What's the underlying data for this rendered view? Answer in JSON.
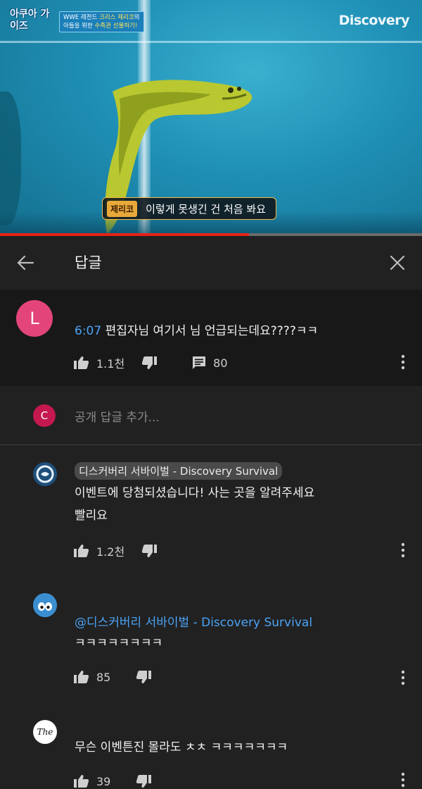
{
  "video": {
    "show_logo": "아쿠아 가이즈",
    "episode_banner_line1_a": "WWE 레전드 ",
    "episode_banner_line1_b": "크리스 제리코",
    "episode_banner_line1_c": "의",
    "episode_banner_line2_a": "아들을 위한 ",
    "episode_banner_line2_b": "수족관 선물하기!",
    "channel_watermark": "Discovery",
    "subtitle_speaker": "제리코",
    "subtitle_text": "이렇게 못생긴 건 처음 봐요",
    "progress_fraction": 0.59
  },
  "header": {
    "title": "답글",
    "back_icon": "arrow-left-icon",
    "close_icon": "close-icon"
  },
  "parent_comment": {
    "avatar_letter": "L",
    "avatar_color": "#e3457b",
    "timestamp": "6:07",
    "text": " 편집자님 여기서 님 언급되는데요????ㅋㅋ",
    "likes": "1.1천",
    "replies": "80"
  },
  "add_reply": {
    "avatar_letter": "C",
    "avatar_color": "#c4184f",
    "placeholder": "공개 답글 추가..."
  },
  "replies": [
    {
      "author": "디스커버리 서바이벌 - Discovery Survival",
      "text_line1": "이벤트에 당첨되셨습니다! 사는 곳을 알려주세요",
      "text_line2": "빨리요",
      "likes": "1.2천"
    },
    {
      "mention": "@디스커버리 서바이벌 - Discovery Survival",
      "text": "ㅋㅋㅋㅋㅋㅋㅋㅋ",
      "likes": "85"
    },
    {
      "avatar_text": "The",
      "text": "무슨 이벤튼진 몰라도 ㅊㅊ ㅋㅋㅋㅋㅋㅋㅋ",
      "likes": "39"
    }
  ],
  "colors": {
    "background": "#212121",
    "parent_background": "#181818",
    "link_blue": "#4aa3f5",
    "progress_red": "#e62117"
  }
}
